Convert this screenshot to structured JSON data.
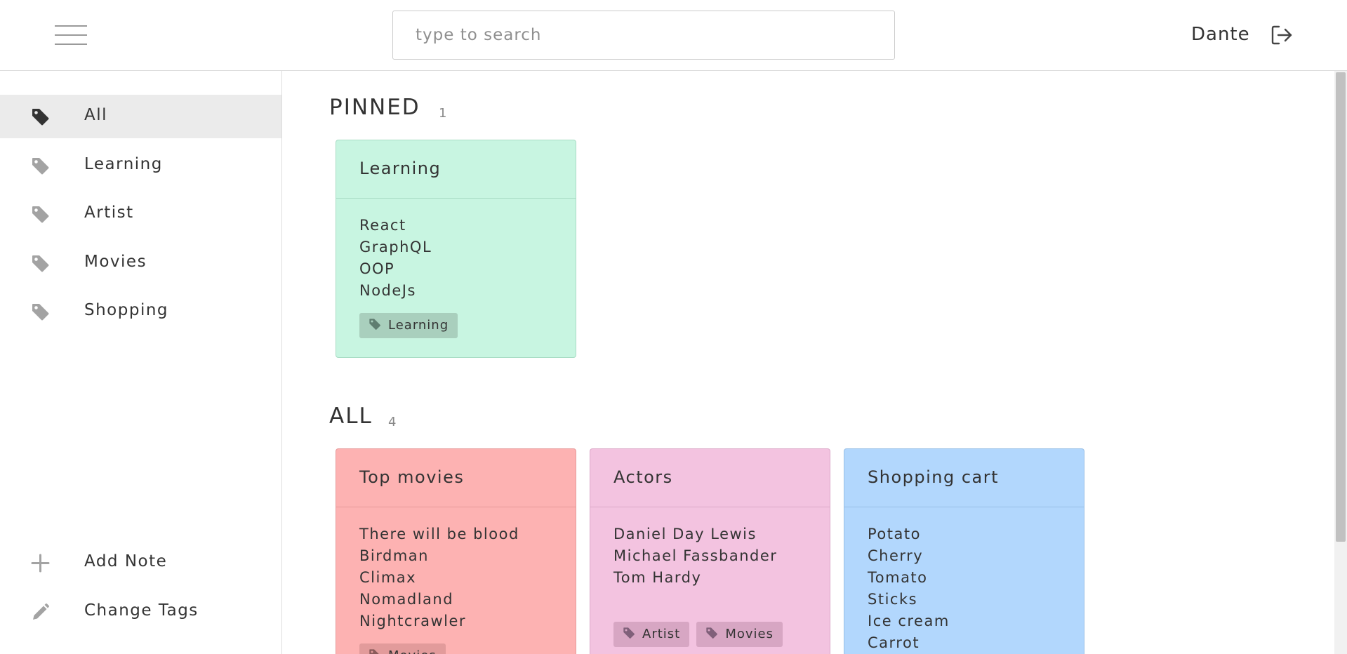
{
  "header": {
    "search_placeholder": "type to search",
    "user_name": "Dante"
  },
  "sidebar": {
    "items": [
      {
        "label": "All",
        "icon": "tag-icon",
        "active": true
      },
      {
        "label": "Learning",
        "icon": "tag-icon"
      },
      {
        "label": "Artist",
        "icon": "tag-icon"
      },
      {
        "label": "Movies",
        "icon": "tag-icon"
      },
      {
        "label": "Shopping",
        "icon": "tag-icon"
      }
    ],
    "actions": [
      {
        "label": "Add Note",
        "icon": "plus-icon"
      },
      {
        "label": "Change Tags",
        "icon": "pencil-icon"
      }
    ]
  },
  "pinned": {
    "title": "PINNED",
    "count": "1",
    "notes": [
      {
        "title": "Learning",
        "lines": [
          "React",
          "GraphQL",
          "OOP",
          "NodeJs"
        ],
        "tags": [
          "Learning"
        ]
      }
    ]
  },
  "all": {
    "title": "ALL",
    "count": "4",
    "notes": [
      {
        "title": "Top movies",
        "lines": [
          "There will be blood",
          "Birdman",
          "Climax",
          "Nomadland",
          "Nightcrawler"
        ],
        "tags": [
          "Movies"
        ]
      },
      {
        "title": "Actors",
        "lines": [
          "Daniel Day Lewis",
          "Michael Fassbander",
          "Tom Hardy"
        ],
        "tags": [
          "Artist",
          "Movies"
        ]
      },
      {
        "title": "Shopping cart",
        "lines": [
          "Potato",
          "Cherry",
          "Tomato",
          "Sticks",
          "Ice cream",
          "Carrot"
        ],
        "tags": []
      }
    ]
  },
  "colors": {
    "pinned_bg": "#c8f5e1",
    "pinned_border": "#a8dcc4",
    "movies_bg": "#fdb2b2",
    "movies_border": "#e69a9a",
    "actors_bg": "#f3c3e0",
    "actors_border": "#dba8c8",
    "shopping_bg": "#b2d7fd",
    "shopping_border": "#98bfe6",
    "tag_pinned": "#a9cfbd",
    "tag_movies": "#e29b9b",
    "tag_actors": "#d7a6c3",
    "active_item": "#ebebeb"
  }
}
